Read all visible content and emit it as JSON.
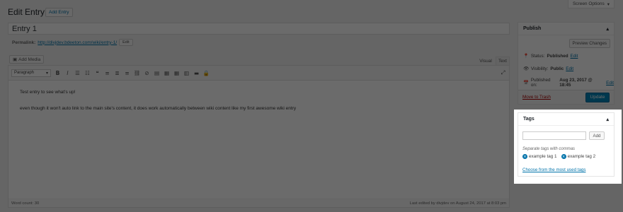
{
  "header": {
    "screen_options": "Screen Options",
    "title": "Edit Entry",
    "add_button": "Add Entry"
  },
  "post": {
    "title": "Entry 1",
    "permalink_label": "Permalink:",
    "permalink_url": "http://divjdev.bdeeton.com/wiki/entry-1/",
    "permalink_edit": "Edit"
  },
  "editor": {
    "add_media": "Add Media",
    "tab_visual": "Visual",
    "tab_text": "Text",
    "format_select": "Paragraph",
    "content": [
      "Test entry to see what's up!",
      "even though it won't auto link to the main site's content, it does work automatically between wiki content like my first awesome wiki entry"
    ],
    "word_count": "Word count: 30",
    "last_edited": "Last edited by divjdev on August 24, 2017 at 8:03 pm"
  },
  "publish": {
    "title": "Publish",
    "preview": "Preview Changes",
    "status_label": "Status:",
    "status_value": "Published",
    "visibility_label": "Visibility:",
    "visibility_value": "Public",
    "published_label": "Published on:",
    "published_value": "Aug 23, 2017 @ 18:45",
    "edit": "Edit",
    "trash": "Move to Trash",
    "update": "Update"
  },
  "tags": {
    "title": "Tags",
    "add": "Add",
    "hint": "Separate tags with commas",
    "items": [
      "example tag 1",
      "example tag 2"
    ],
    "most_used": "Choose from the most used tags"
  },
  "colors": {
    "accent": "#0085ba",
    "link": "#0073aa",
    "overlay": "rgba(0,0,0,0.58)"
  }
}
